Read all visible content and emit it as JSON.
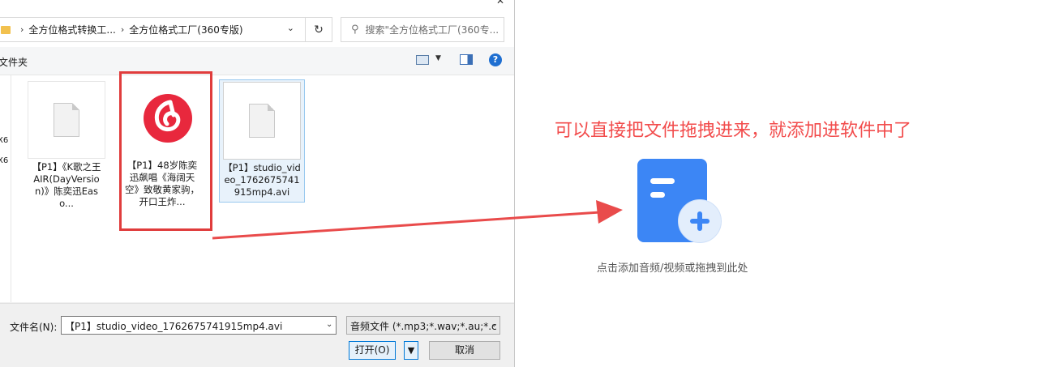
{
  "dialog": {
    "breadcrumbs": [
      "全方位格式转换工...",
      "全方位格式工厂(360专版)"
    ],
    "search_placeholder": "搜索\"全方位格式工厂(360专...",
    "new_folder_label": "文件夹",
    "nav_items": [
      "X6",
      "X6"
    ],
    "files": [
      {
        "name": "【P1】《K歌之王AIR(DayVersion)》陈奕迅Easo...",
        "icon": "document-icon"
      },
      {
        "name": "【P1】48岁陈奕迅飙唱《海阔天空》致敬黄家驹，开口王炸...",
        "icon": "netease-music-icon"
      },
      {
        "name": "【P1】studio_video_1762675741915mp4.avi",
        "icon": "document-icon"
      }
    ],
    "filename_label": "文件名(N):",
    "filename_value": "【P1】studio_video_1762675741915mp4.avi",
    "filetype_value": "音频文件 (*.mp3;*.wav;*.au;*.c",
    "open_label": "打开(O)",
    "cancel_label": "取消"
  },
  "right": {
    "annotation": "可以直接把文件拖拽进来，就添加进软件中了",
    "drop_hint": "点击添加音频/视频或拖拽到此处"
  },
  "colors": {
    "annotation": "#f24c4c",
    "highlight_box": "#e03c3c",
    "accent_blue": "#3c86f5",
    "netease_red": "#e8283d"
  }
}
